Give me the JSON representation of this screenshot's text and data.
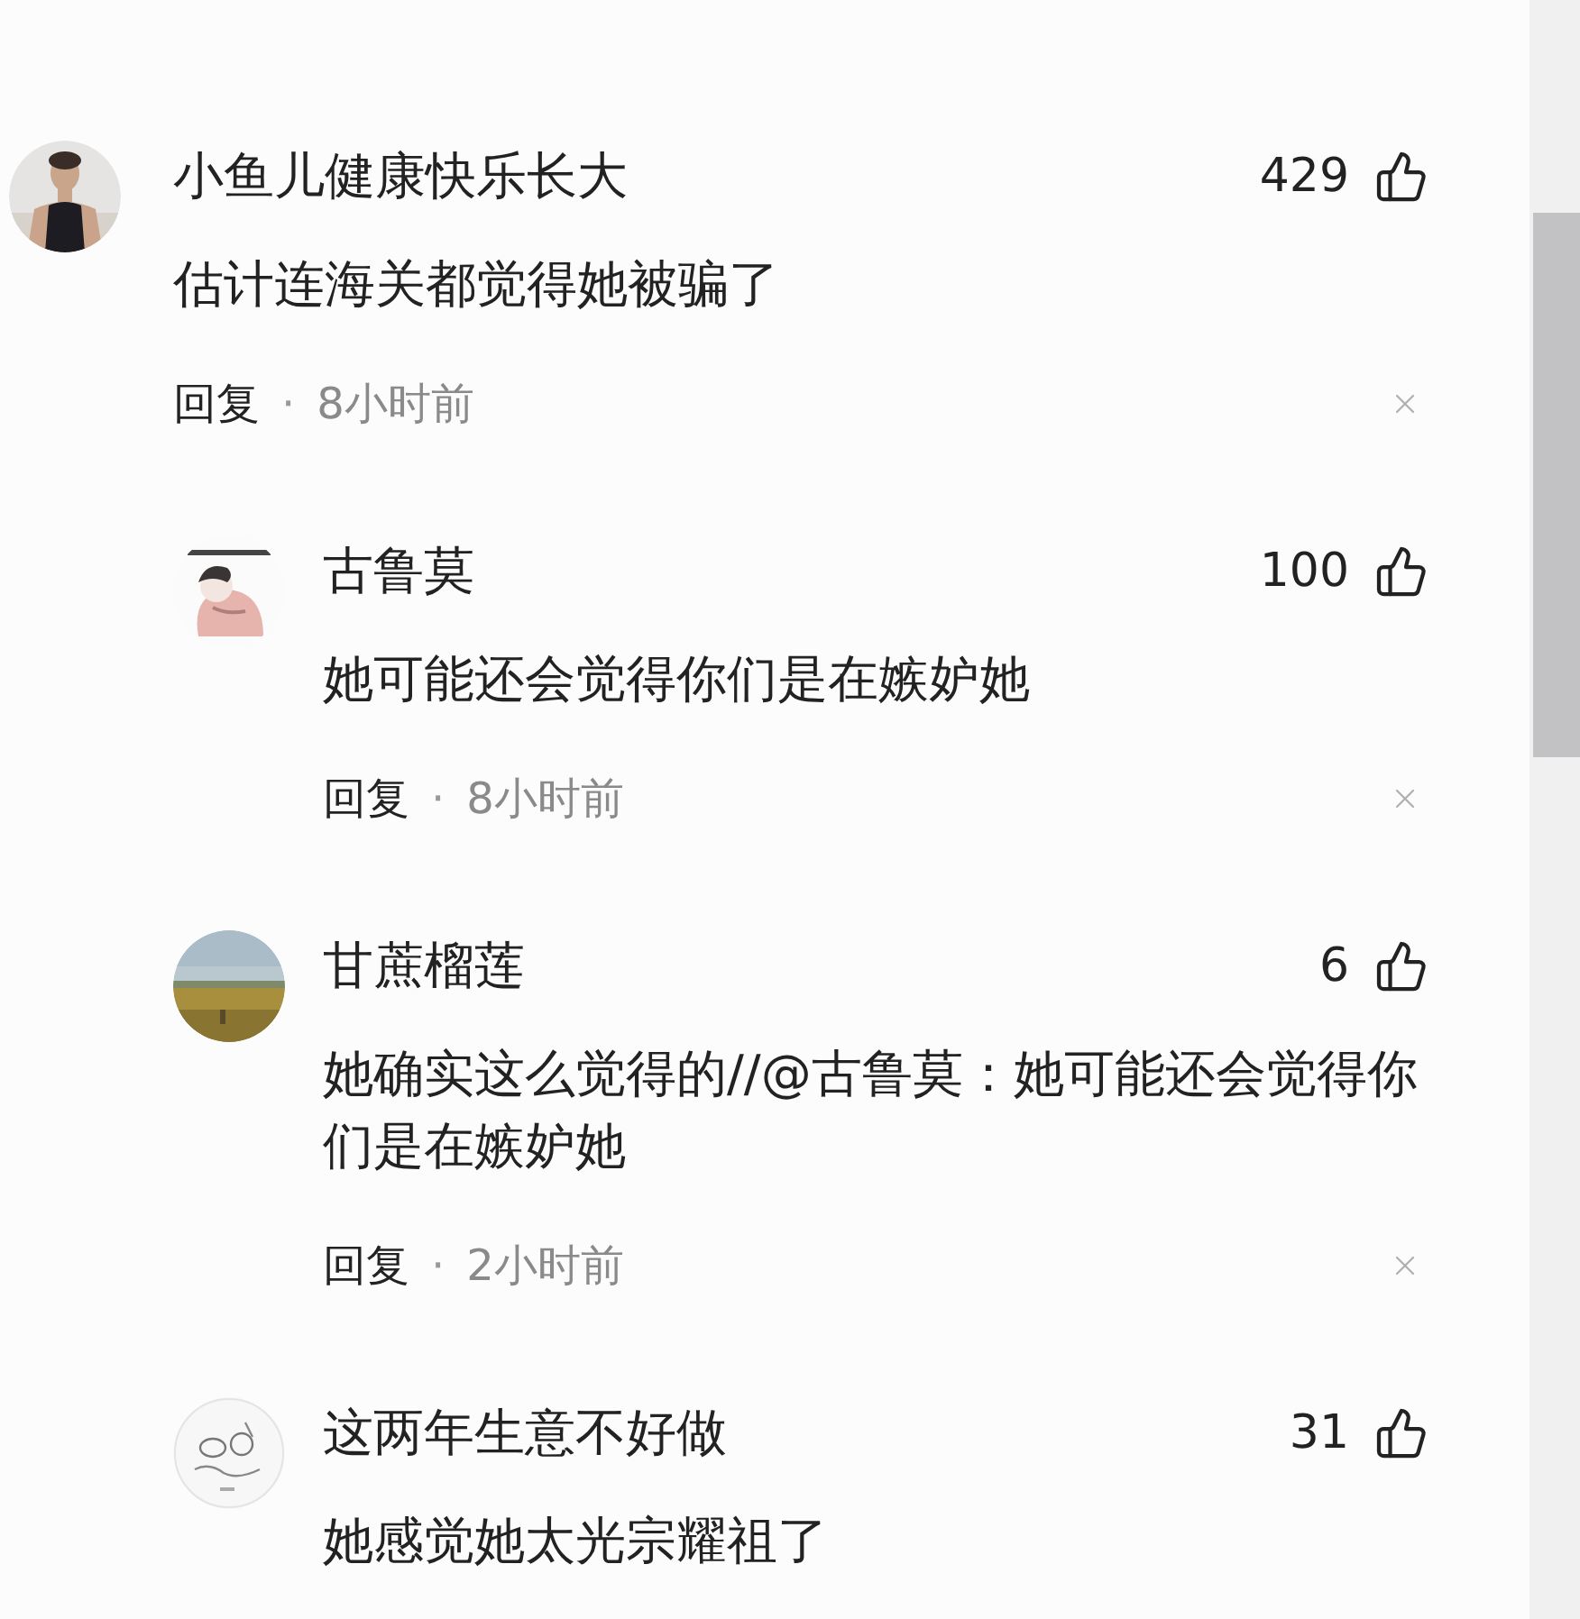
{
  "comments": [
    {
      "user": "小鱼儿健康快乐长大",
      "likes": "429",
      "text": "估计连海关都觉得她被骗了",
      "reply_label": "回复",
      "separator": "·",
      "time": "8小时前",
      "children": [
        {
          "user": "古鲁莫",
          "likes": "100",
          "text": "她可能还会觉得你们是在嫉妒她",
          "reply_label": "回复",
          "separator": "·",
          "time": "8小时前"
        },
        {
          "user": "甘蔗榴莲",
          "likes": "6",
          "text": "她确实这么觉得的//@古鲁莫：她可能还会觉得你们是在嫉妒她",
          "reply_label": "回复",
          "separator": "·",
          "time": "2小时前"
        },
        {
          "user": "这两年生意不好做",
          "likes": "31",
          "text": "她感觉她太光宗耀祖了"
        }
      ]
    }
  ]
}
